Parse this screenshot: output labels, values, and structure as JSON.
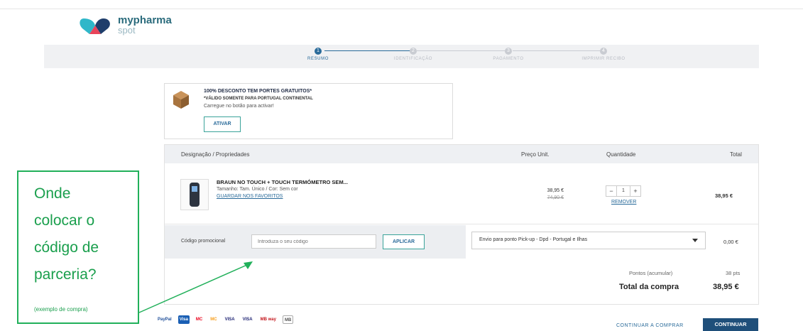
{
  "logo": {
    "line1": "mypharma",
    "line2": "spot"
  },
  "steps": [
    {
      "number": "1",
      "label": "RESUMO",
      "active": true
    },
    {
      "number": "2",
      "label": "IDENTIFICAÇÃO",
      "active": false
    },
    {
      "number": "3",
      "label": "PAGAMENTO",
      "active": false
    },
    {
      "number": "4",
      "label": "IMPRIMIR RECIBO",
      "active": false
    }
  ],
  "promo_banner": {
    "title": "100% DESCONTO TEM PORTES GRATUITOS*",
    "subtitle": "*VÁLIDO SOMENTE PARA PORTUGAL CONTINENTAL",
    "hint": "Carregue no botão para activar!",
    "button": "ATIVAR"
  },
  "cart": {
    "headers": {
      "name": "Designação / Propriedades",
      "unit_price": "Preço Unit.",
      "quantity": "Quantidade",
      "total": "Total"
    },
    "items": [
      {
        "name": "BRAUN NO TOUCH + TOUCH TERMÓMETRO SEM...",
        "props": "Tamanho: Tam. Único / Cor: Sem cor",
        "favorite_link": "GUARDAR NOS FAVORITOS",
        "price": "38,95 €",
        "old_price": "74,90 €",
        "quantity": "1",
        "remove_link": "REMOVER",
        "line_total": "38,95 €"
      }
    ],
    "promo_code": {
      "label": "Código promocional",
      "placeholder": "Introduza o seu código",
      "button": "APLICAR"
    },
    "shipping": {
      "selected": "Envio para ponto Pick-up - Dpd - Portugal e Ilhas",
      "cost": "0,00 €"
    },
    "points": {
      "label": "Pontos (acumular)",
      "value": "38 pts"
    },
    "total": {
      "label": "Total da compra",
      "value": "38,95 €"
    }
  },
  "payments": [
    "PayPal",
    "Visa",
    "MC",
    "MC",
    "VISA",
    "VISA",
    "MB way",
    "MB"
  ],
  "actions": {
    "continue_shopping": "CONTINUAR A COMPRAR",
    "continue": "CONTINUAR"
  },
  "annotation": {
    "lines": [
      "Onde",
      "colocar o",
      "código de",
      "parceria?"
    ],
    "note": "(exemplo de compra)"
  },
  "colors": {
    "accent": "#2a6b9a",
    "annotation": "#1a9f4d",
    "primary_button": "#1f4f7a"
  }
}
